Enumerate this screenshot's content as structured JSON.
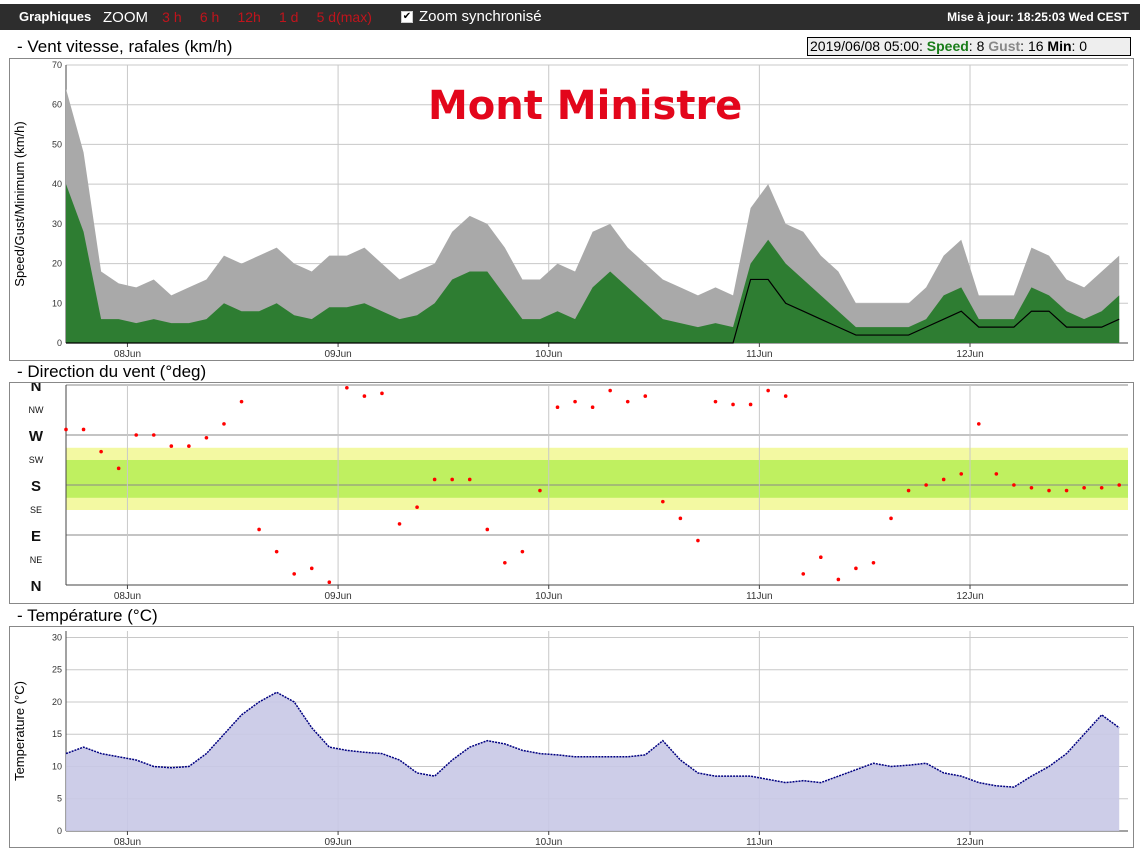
{
  "toolbar": {
    "graphiques": "Graphiques",
    "zoom_label": "ZOOM",
    "zoom_links": [
      "3 h",
      "6 h",
      "12h",
      "1 d",
      "5 d(max)"
    ],
    "sync_label": "Zoom synchronisé",
    "last_update": "Mise à jour: 18:25:03 Wed CEST"
  },
  "station_name": "Mont Ministre",
  "colors": {
    "wind_speed": "#2e7d32",
    "wind_gust": "#a9a9a9",
    "wind_min": "#000000",
    "direction": "#ff0000",
    "temperature_line": "#000080",
    "temperature_fill": "#c8c8e6",
    "band_yellow": "#f3f9a2",
    "band_green": "#bff060"
  },
  "wind_panel": {
    "title": "- Vent vitesse, rafales (km/h)",
    "info": {
      "time": "2019/06/08 05:00:",
      "speed_label": "Speed",
      "speed": "8",
      "gust_label": "Gust",
      "gust": "16",
      "min_label": "Min",
      "min": "0"
    }
  },
  "direction_panel": {
    "title": "- Direction du vent (°deg)"
  },
  "temperature_panel": {
    "title": "- Température (°C)"
  },
  "chart_data": [
    {
      "type": "area",
      "ylabel": "Speed/Gust/Minimum (km/h)",
      "ylim": [
        0,
        70
      ],
      "yticks": [
        0,
        10,
        20,
        30,
        40,
        50,
        60,
        70
      ],
      "xticks": [
        "08Jun",
        "09Jun",
        "10Jun",
        "11Jun",
        "12Jun"
      ],
      "grid": true,
      "x": [
        "07Jun 17:00",
        "07Jun 19:00",
        "07Jun 21:00",
        "07Jun 23:00",
        "08Jun 01:00",
        "08Jun 03:00",
        "08Jun 05:00",
        "08Jun 07:00",
        "08Jun 09:00",
        "08Jun 11:00",
        "08Jun 13:00",
        "08Jun 15:00",
        "08Jun 17:00",
        "08Jun 19:00",
        "08Jun 21:00",
        "08Jun 23:00",
        "09Jun 01:00",
        "09Jun 03:00",
        "09Jun 05:00",
        "09Jun 07:00",
        "09Jun 09:00",
        "09Jun 11:00",
        "09Jun 13:00",
        "09Jun 15:00",
        "09Jun 17:00",
        "09Jun 19:00",
        "09Jun 21:00",
        "09Jun 23:00",
        "10Jun 01:00",
        "10Jun 03:00",
        "10Jun 05:00",
        "10Jun 07:00",
        "10Jun 09:00",
        "10Jun 11:00",
        "10Jun 13:00",
        "10Jun 15:00",
        "10Jun 17:00",
        "10Jun 19:00",
        "10Jun 21:00",
        "10Jun 23:00",
        "11Jun 01:00",
        "11Jun 03:00",
        "11Jun 05:00",
        "11Jun 07:00",
        "11Jun 09:00",
        "11Jun 11:00",
        "11Jun 13:00",
        "11Jun 15:00",
        "11Jun 17:00",
        "11Jun 19:00",
        "11Jun 21:00",
        "11Jun 23:00",
        "12Jun 01:00",
        "12Jun 03:00",
        "12Jun 05:00",
        "12Jun 07:00",
        "12Jun 09:00",
        "12Jun 11:00",
        "12Jun 13:00",
        "12Jun 15:00",
        "12Jun 17:00"
      ],
      "series": [
        {
          "name": "Gust",
          "values": [
            64,
            48,
            18,
            15,
            14,
            16,
            12,
            14,
            16,
            22,
            20,
            22,
            24,
            20,
            18,
            22,
            22,
            24,
            20,
            16,
            18,
            20,
            28,
            32,
            30,
            24,
            16,
            16,
            20,
            18,
            28,
            30,
            24,
            20,
            16,
            14,
            12,
            14,
            12,
            34,
            40,
            30,
            28,
            22,
            18,
            10,
            10,
            10,
            10,
            14,
            22,
            26,
            12,
            12,
            12,
            24,
            22,
            16,
            14,
            18,
            22
          ]
        },
        {
          "name": "Speed",
          "values": [
            40,
            28,
            6,
            6,
            5,
            6,
            5,
            5,
            6,
            10,
            8,
            8,
            10,
            7,
            6,
            9,
            9,
            10,
            8,
            6,
            7,
            10,
            16,
            18,
            18,
            12,
            6,
            6,
            8,
            6,
            14,
            18,
            14,
            10,
            6,
            5,
            4,
            5,
            4,
            20,
            26,
            20,
            16,
            12,
            8,
            4,
            4,
            4,
            4,
            6,
            12,
            14,
            6,
            6,
            6,
            14,
            12,
            8,
            6,
            8,
            12
          ]
        },
        {
          "name": "Minimum",
          "values": [
            0,
            0,
            0,
            0,
            0,
            0,
            0,
            0,
            0,
            0,
            0,
            0,
            0,
            0,
            0,
            0,
            0,
            0,
            0,
            0,
            0,
            0,
            0,
            0,
            0,
            0,
            0,
            0,
            0,
            0,
            0,
            0,
            0,
            0,
            0,
            0,
            0,
            0,
            0,
            16,
            16,
            10,
            8,
            6,
            4,
            2,
            2,
            2,
            2,
            4,
            6,
            8,
            4,
            4,
            4,
            8,
            8,
            4,
            4,
            4,
            6
          ]
        }
      ]
    },
    {
      "type": "scatter",
      "yticks": [
        "N",
        "NE",
        "E",
        "SE",
        "S",
        "SW",
        "W",
        "NW",
        "N"
      ],
      "xticks": [
        "08Jun",
        "09Jun",
        "10Jun",
        "11Jun",
        "12Jun"
      ],
      "grid": true,
      "bands": [
        {
          "from": 135,
          "to": 247
        },
        {
          "from": 157,
          "to": 225
        }
      ],
      "points": [
        [
          "07Jun 17:00",
          280
        ],
        [
          "07Jun 19:00",
          280
        ],
        [
          "07Jun 21:00",
          240
        ],
        [
          "07Jun 23:00",
          210
        ],
        [
          "08Jun 01:00",
          270
        ],
        [
          "08Jun 03:00",
          270
        ],
        [
          "08Jun 05:00",
          250
        ],
        [
          "08Jun 07:00",
          250
        ],
        [
          "08Jun 09:00",
          265
        ],
        [
          "08Jun 11:00",
          290
        ],
        [
          "08Jun 13:00",
          330
        ],
        [
          "08Jun 15:00",
          100
        ],
        [
          "08Jun 17:00",
          60
        ],
        [
          "08Jun 19:00",
          20
        ],
        [
          "08Jun 21:00",
          30
        ],
        [
          "08Jun 23:00",
          5
        ],
        [
          "09Jun 01:00",
          355
        ],
        [
          "09Jun 03:00",
          340
        ],
        [
          "09Jun 05:00",
          345
        ],
        [
          "09Jun 07:00",
          110
        ],
        [
          "09Jun 09:00",
          140
        ],
        [
          "09Jun 11:00",
          190
        ],
        [
          "09Jun 13:00",
          190
        ],
        [
          "09Jun 15:00",
          190
        ],
        [
          "09Jun 17:00",
          100
        ],
        [
          "09Jun 19:00",
          40
        ],
        [
          "09Jun 21:00",
          60
        ],
        [
          "09Jun 23:00",
          170
        ],
        [
          "10Jun 01:00",
          320
        ],
        [
          "10Jun 03:00",
          330
        ],
        [
          "10Jun 05:00",
          320
        ],
        [
          "10Jun 07:00",
          350
        ],
        [
          "10Jun 09:00",
          330
        ],
        [
          "10Jun 11:00",
          340
        ],
        [
          "10Jun 13:00",
          150
        ],
        [
          "10Jun 15:00",
          120
        ],
        [
          "10Jun 17:00",
          80
        ],
        [
          "10Jun 19:00",
          330
        ],
        [
          "10Jun 21:00",
          325
        ],
        [
          "10Jun 23:00",
          325
        ],
        [
          "11Jun 01:00",
          350
        ],
        [
          "11Jun 03:00",
          340
        ],
        [
          "11Jun 05:00",
          20
        ],
        [
          "11Jun 07:00",
          50
        ],
        [
          "11Jun 09:00",
          10
        ],
        [
          "11Jun 11:00",
          30
        ],
        [
          "11Jun 13:00",
          40
        ],
        [
          "11Jun 15:00",
          120
        ],
        [
          "11Jun 17:00",
          170
        ],
        [
          "11Jun 19:00",
          180
        ],
        [
          "11Jun 21:00",
          190
        ],
        [
          "11Jun 23:00",
          200
        ],
        [
          "12Jun 01:00",
          290
        ],
        [
          "12Jun 03:00",
          200
        ],
        [
          "12Jun 05:00",
          180
        ],
        [
          "12Jun 07:00",
          175
        ],
        [
          "12Jun 09:00",
          170
        ],
        [
          "12Jun 11:00",
          170
        ],
        [
          "12Jun 13:00",
          175
        ],
        [
          "12Jun 15:00",
          175
        ],
        [
          "12Jun 17:00",
          180
        ]
      ]
    },
    {
      "type": "area",
      "ylabel": "Temperature (°C)",
      "ylim": [
        0,
        31
      ],
      "yticks": [
        0,
        5,
        10,
        15,
        20,
        25,
        30
      ],
      "xticks": [
        "08Jun",
        "09Jun",
        "10Jun",
        "11Jun",
        "12Jun"
      ],
      "grid": true,
      "x": [
        "07Jun 17:00",
        "07Jun 19:00",
        "07Jun 21:00",
        "07Jun 23:00",
        "08Jun 01:00",
        "08Jun 03:00",
        "08Jun 05:00",
        "08Jun 07:00",
        "08Jun 09:00",
        "08Jun 11:00",
        "08Jun 13:00",
        "08Jun 15:00",
        "08Jun 17:00",
        "08Jun 19:00",
        "08Jun 21:00",
        "08Jun 23:00",
        "09Jun 01:00",
        "09Jun 03:00",
        "09Jun 05:00",
        "09Jun 07:00",
        "09Jun 09:00",
        "09Jun 11:00",
        "09Jun 13:00",
        "09Jun 15:00",
        "09Jun 17:00",
        "09Jun 19:00",
        "09Jun 21:00",
        "09Jun 23:00",
        "10Jun 01:00",
        "10Jun 03:00",
        "10Jun 05:00",
        "10Jun 07:00",
        "10Jun 09:00",
        "10Jun 11:00",
        "10Jun 13:00",
        "10Jun 15:00",
        "10Jun 17:00",
        "10Jun 19:00",
        "10Jun 21:00",
        "10Jun 23:00",
        "11Jun 01:00",
        "11Jun 03:00",
        "11Jun 05:00",
        "11Jun 07:00",
        "11Jun 09:00",
        "11Jun 11:00",
        "11Jun 13:00",
        "11Jun 15:00",
        "11Jun 17:00",
        "11Jun 19:00",
        "11Jun 21:00",
        "11Jun 23:00",
        "12Jun 01:00",
        "12Jun 03:00",
        "12Jun 05:00",
        "12Jun 07:00",
        "12Jun 09:00",
        "12Jun 11:00",
        "12Jun 13:00",
        "12Jun 15:00",
        "12Jun 17:00"
      ],
      "series": [
        {
          "name": "Temperature",
          "values": [
            12,
            13,
            12,
            11.5,
            11,
            10,
            9.8,
            10,
            12,
            15,
            18,
            20,
            21.5,
            20,
            16,
            13,
            12.5,
            12.2,
            12,
            11,
            9,
            8.5,
            11,
            13,
            14,
            13.5,
            12.5,
            12,
            11.8,
            11.5,
            11.5,
            11.5,
            11.5,
            11.8,
            14,
            11,
            9,
            8.5,
            8.5,
            8.5,
            8,
            7.5,
            7.8,
            7.5,
            8.5,
            9.5,
            10.5,
            10,
            10.2,
            10.5,
            9,
            8.5,
            7.5,
            7,
            6.8,
            8.5,
            10,
            12,
            15,
            18,
            16
          ]
        }
      ]
    }
  ]
}
